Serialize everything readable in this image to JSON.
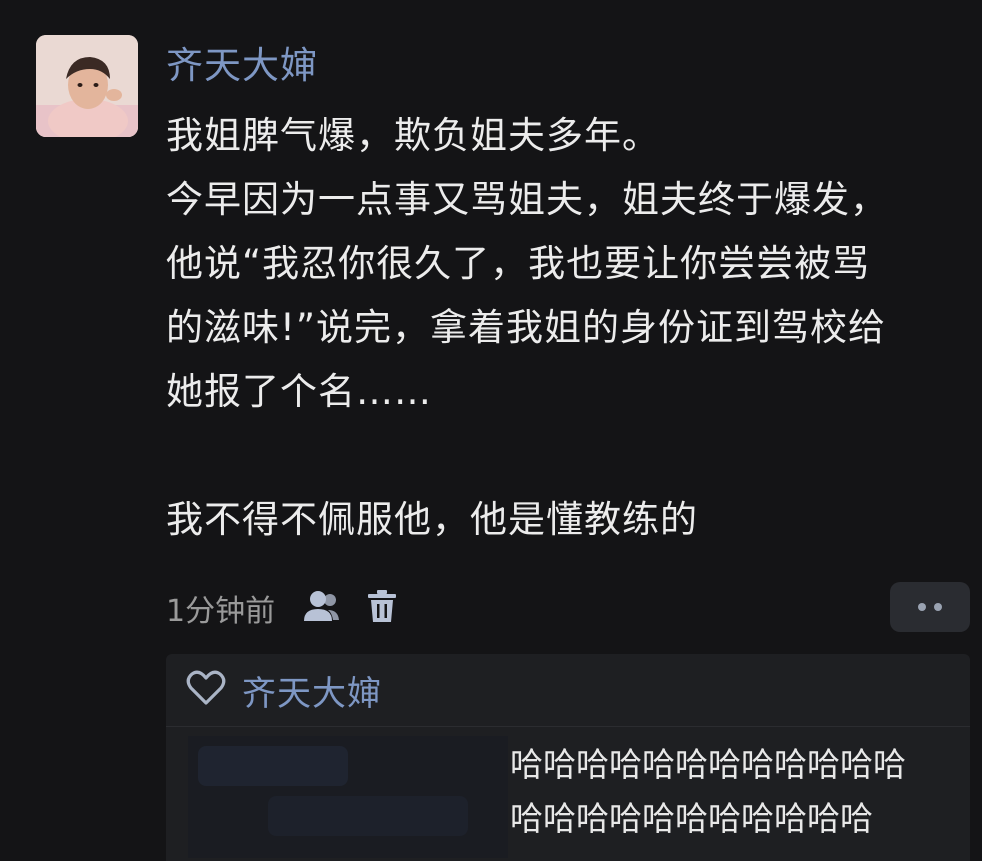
{
  "comment": {
    "author": "齐天大婶",
    "lines": [
      "我姐脾气爆，欺负姐夫多年。",
      "今早因为一点事又骂姐夫，姐夫终于爆发，",
      "他说“我忍你很久了，我也要让你尝尝被骂",
      "的滋味!”说完，拿着我姐的身份证到驾校给",
      "她报了个名……"
    ],
    "closing": "我不得不佩服他，他是懂教练的",
    "timestamp": "1分钟前",
    "icons": {
      "author_action": "person-icon",
      "delete": "trash-icon",
      "more": "more-dots-icon",
      "like": "heart-outline-icon"
    }
  },
  "reply": {
    "liked_by": "齐天大婶",
    "lines": [
      "哈哈哈哈哈哈哈哈哈哈哈哈",
      "哈哈哈哈哈哈哈哈哈哈哈"
    ]
  },
  "colors": {
    "background": "#141416",
    "author_name": "#7e97c4",
    "body_text": "#ececec",
    "muted_text": "#9a9a9a",
    "panel": "#1e1f22"
  }
}
